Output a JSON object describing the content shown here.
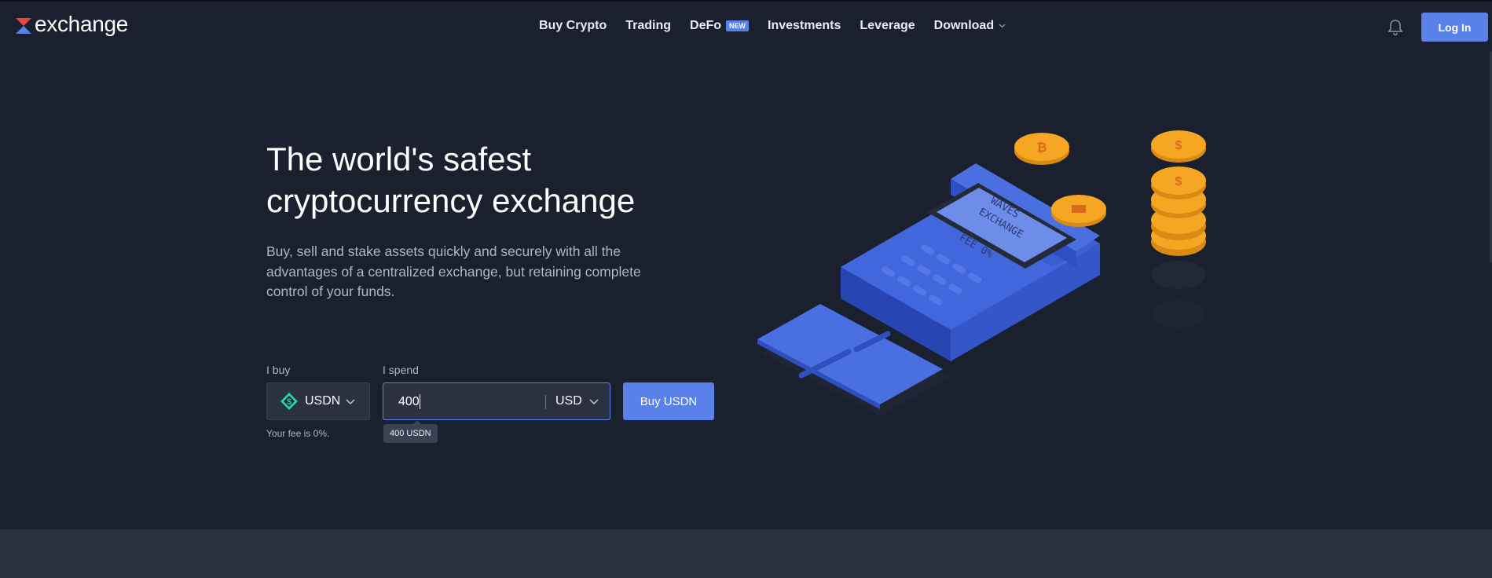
{
  "header": {
    "logo_text": "exchange",
    "nav": [
      {
        "label": "Buy Crypto"
      },
      {
        "label": "Trading"
      },
      {
        "label": "DeFo",
        "badge": "NEW"
      },
      {
        "label": "Investments"
      },
      {
        "label": "Leverage"
      },
      {
        "label": "Download",
        "has_dropdown": true
      }
    ],
    "login_label": "Log In"
  },
  "hero": {
    "title_line1": "The world's safest",
    "title_line2": "cryptocurrency exchange",
    "subtitle": "Buy, sell and stake assets quickly and securely with all the advantages of a centralized exchange, but retaining complete control of your funds."
  },
  "trade": {
    "buy_label": "I buy",
    "spend_label": "I spend",
    "asset": "USDN",
    "amount": "400",
    "currency": "USD",
    "buy_button": "Buy USDN",
    "fee_note": "Your fee is 0%.",
    "tooltip": "400 USDN"
  },
  "illustration": {
    "screen_line1": "WAVES",
    "screen_line2": "EXCHANGE",
    "screen_line3": "FEE 0%"
  },
  "colors": {
    "background": "#1a202d",
    "accent": "#5a81ea",
    "input_bg": "#2b3140",
    "muted_text": "#aeb6c8",
    "coin": "#f5a623",
    "terminal": "#3d5fd6"
  },
  "icons": {
    "logo": "waves-logo-icon",
    "notifications": "bell-icon",
    "asset": "usdn-token-icon",
    "dropdown": "chevron-down-icon"
  }
}
